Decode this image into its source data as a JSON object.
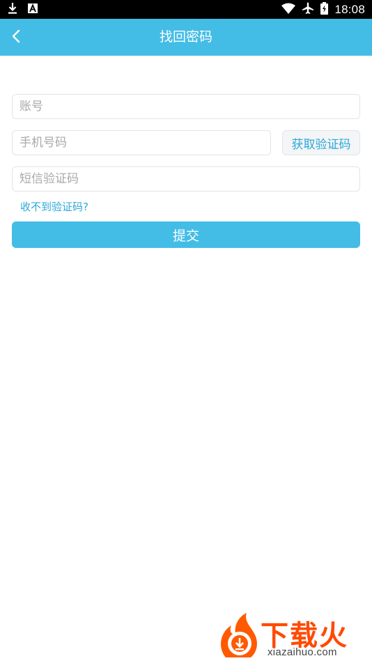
{
  "status_bar": {
    "time": "18:08",
    "icons": [
      "download-icon",
      "a-notification-icon",
      "wifi-icon",
      "airplane-icon",
      "battery-icon"
    ]
  },
  "header": {
    "title": "找回密码",
    "back_icon": "chevron-left-icon",
    "background": "#44bde6"
  },
  "form": {
    "account_placeholder": "账号",
    "phone_placeholder": "手机号码",
    "get_code_label": "获取验证码",
    "sms_code_placeholder": "短信验证码",
    "no_code_link": "收不到验证码?",
    "submit_label": "提交"
  },
  "watermark": {
    "brand": "下载火",
    "url": "xiazaihuo.com"
  },
  "colors": {
    "accent": "#44bde6",
    "link": "#2aa8d8",
    "watermark": "#ff4a00"
  }
}
